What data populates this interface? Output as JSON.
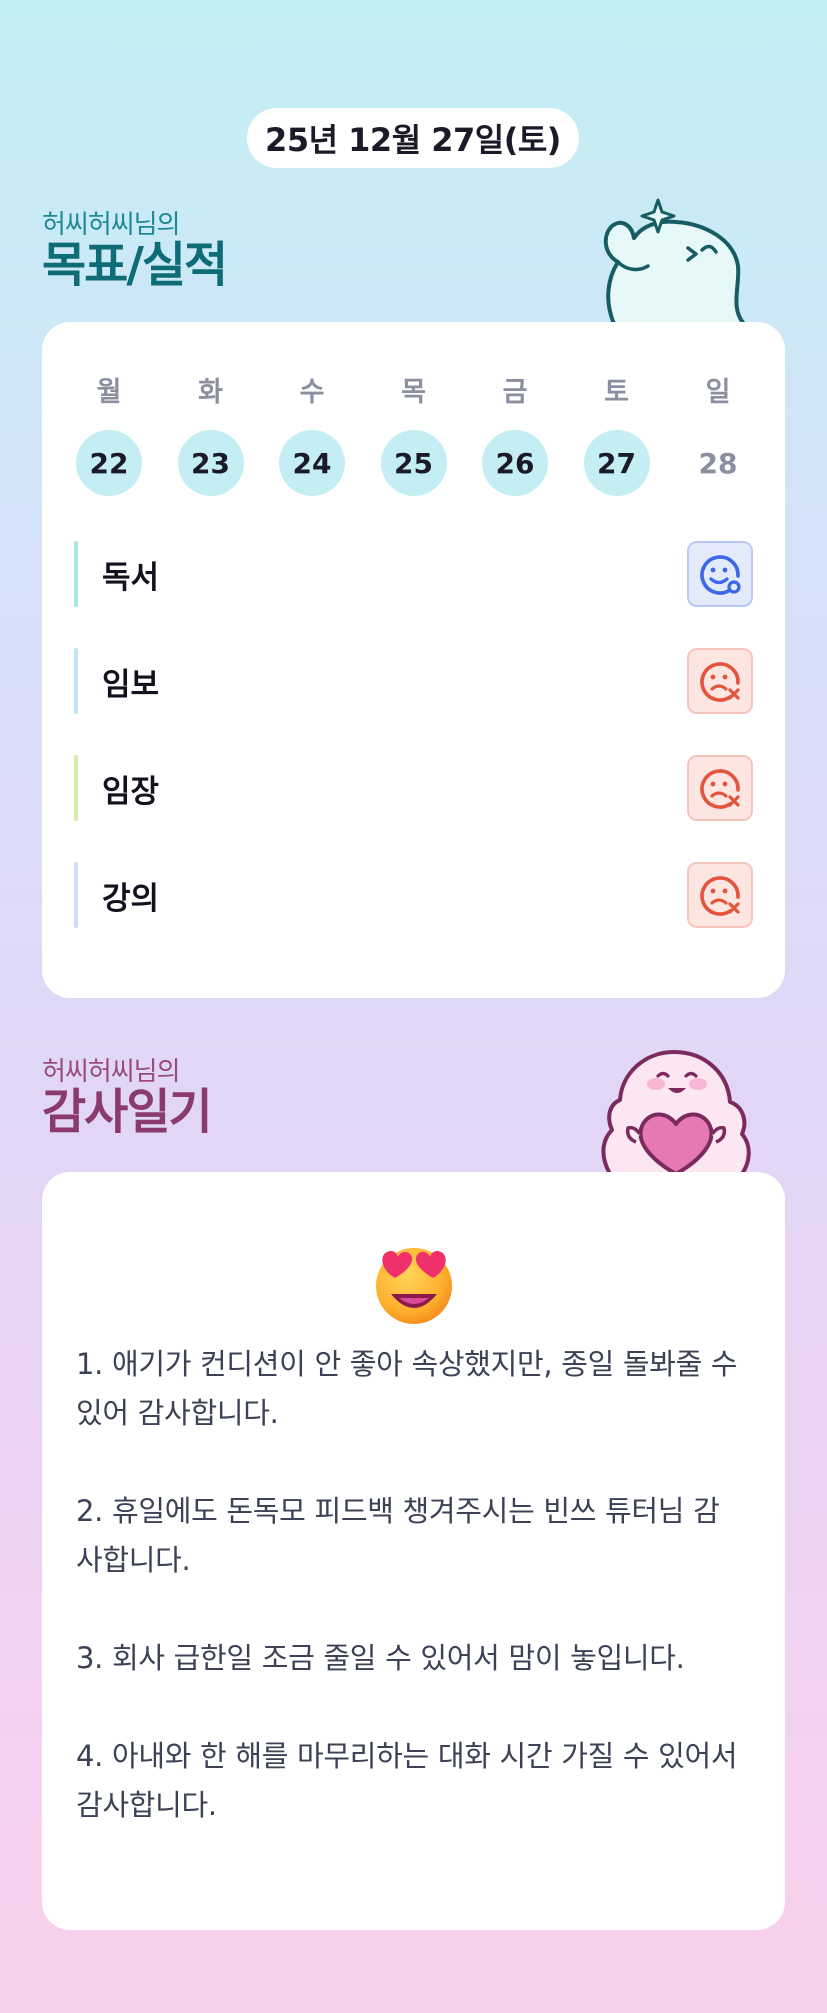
{
  "header": {
    "date": "25년 12월 27일(토)"
  },
  "goal_section": {
    "subtitle": "허씨허씨님의",
    "title": "목표/실적"
  },
  "week": {
    "days": [
      "월",
      "화",
      "수",
      "목",
      "금",
      "토",
      "일"
    ],
    "dates": [
      "22",
      "23",
      "24",
      "25",
      "26",
      "27",
      "28"
    ],
    "completed": [
      true,
      true,
      true,
      true,
      true,
      true,
      false
    ]
  },
  "goals": [
    {
      "name": "독서",
      "status": "done",
      "bar_color": "#a6e8df"
    },
    {
      "name": "임보",
      "status": "missed",
      "bar_color": "#bfe7f7"
    },
    {
      "name": "임장",
      "status": "missed",
      "bar_color": "#d6ecb0"
    },
    {
      "name": "강의",
      "status": "missed",
      "bar_color": "#cfdcf8"
    }
  ],
  "thanks_section": {
    "subtitle": "허씨허씨님의",
    "title": "감사일기"
  },
  "thanks": {
    "emoji": "heart-eyes-emoji",
    "entries": [
      "1. 애기가 컨디션이 안 좋아 속상했지만, 종일 돌봐줄 수 있어 감사합니다.",
      "2. 휴일에도 돈독모 피드백 챙겨주시는 빈쓰 튜터님 감사합니다.",
      "3. 회사 급한일 조금 줄일 수 있어서 맘이 놓입니다.",
      "4. 아내와 한 해를 마무리하는 대화 시간 가질 수 있어서 감사합니다."
    ]
  },
  "colors": {
    "accent_teal": "#0e6c78",
    "accent_plum": "#8a3a6d",
    "done_blue": "#3b67e8",
    "missed_red": "#e2553c"
  }
}
